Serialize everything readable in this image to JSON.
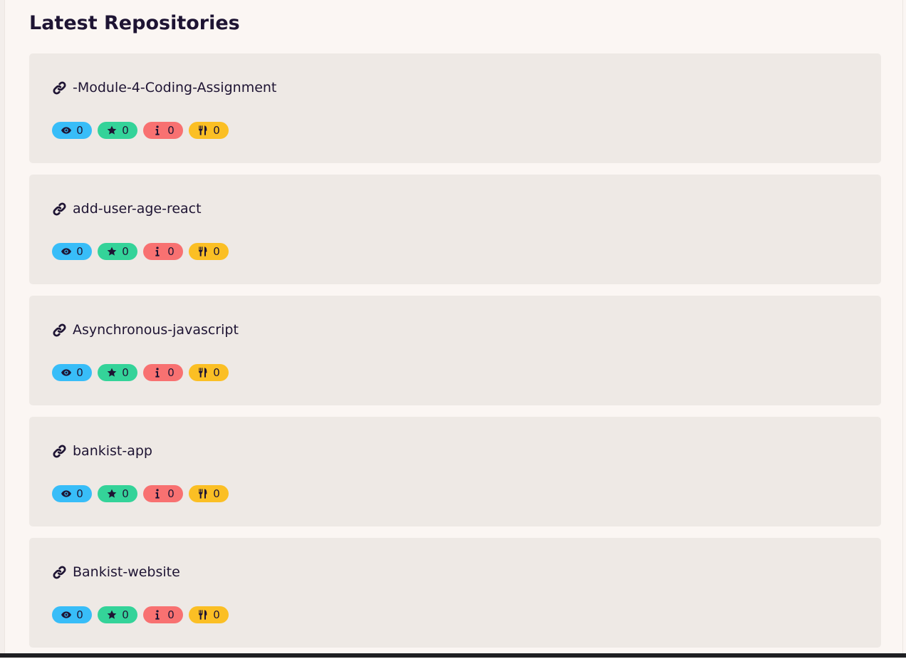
{
  "section": {
    "title": "Latest Repositories"
  },
  "repositories": [
    {
      "name": "-Module-4-Coding-Assignment",
      "watchers": "0",
      "stars": "0",
      "issues": "0",
      "forks": "0"
    },
    {
      "name": "add-user-age-react",
      "watchers": "0",
      "stars": "0",
      "issues": "0",
      "forks": "0"
    },
    {
      "name": "Asynchronous-javascript",
      "watchers": "0",
      "stars": "0",
      "issues": "0",
      "forks": "0"
    },
    {
      "name": "bankist-app",
      "watchers": "0",
      "stars": "0",
      "issues": "0",
      "forks": "0"
    },
    {
      "name": "Bankist-website",
      "watchers": "0",
      "stars": "0",
      "issues": "0",
      "forks": "0"
    }
  ],
  "icons": {
    "repo_link": "link-icon",
    "watchers": "eye-icon",
    "stars": "star-icon",
    "issues": "info-icon",
    "forks": "fork-icon"
  },
  "colors": {
    "watchers_badge": "#38bdf8",
    "stars_badge": "#34d399",
    "issues_badge": "#f87171",
    "forks_badge": "#fbbf24",
    "card_background": "#eee9e5",
    "page_background": "#fbf6f3",
    "text": "#1e1433"
  }
}
